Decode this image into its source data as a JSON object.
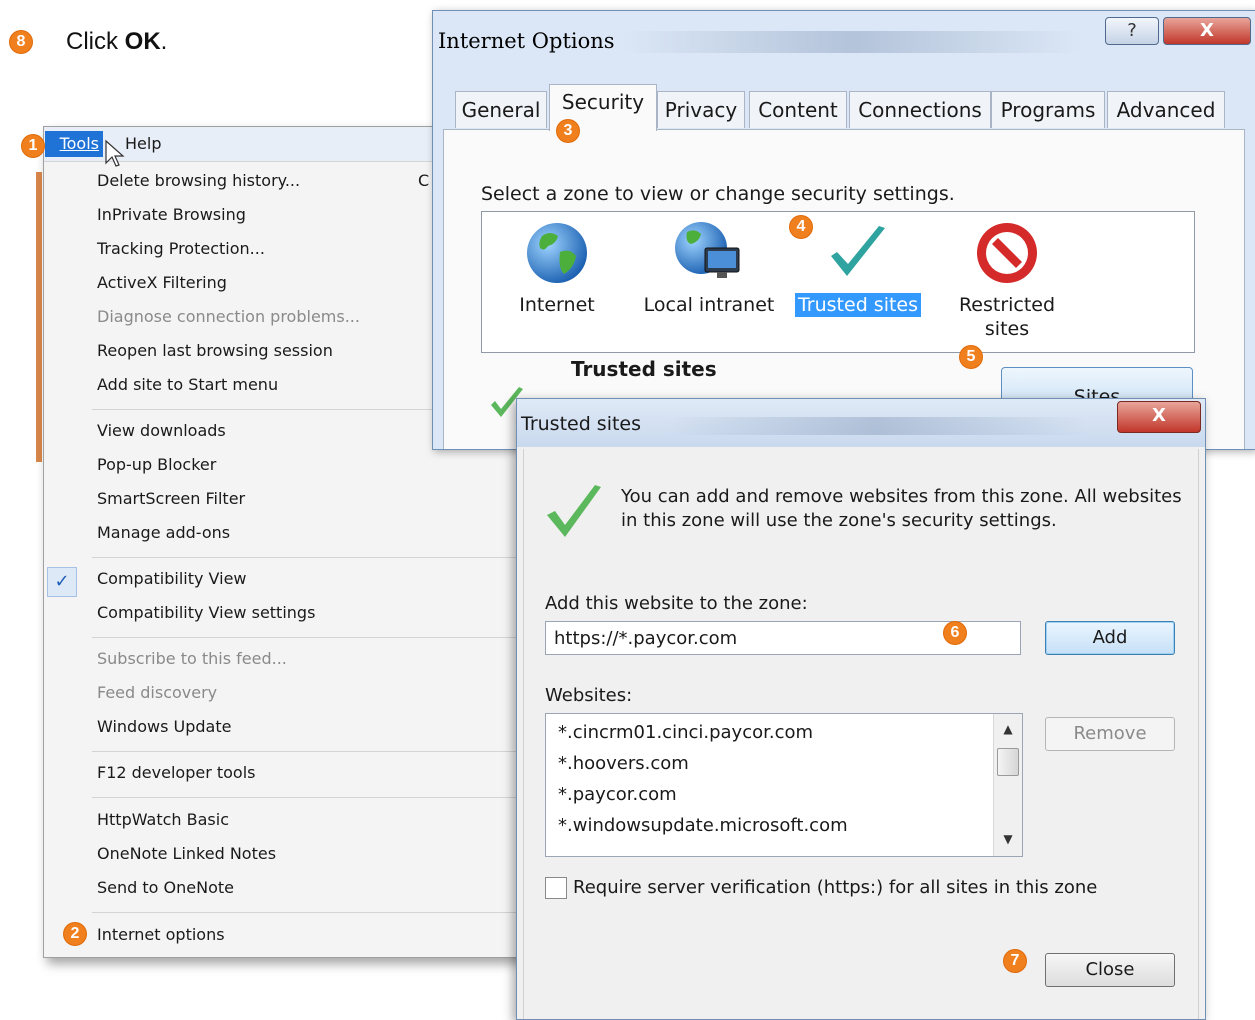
{
  "instruction": {
    "step": "8",
    "prefix": "Click ",
    "bold": "OK",
    "suffix": "."
  },
  "steps": {
    "s1": "1",
    "s2": "2",
    "s3": "3",
    "s4": "4",
    "s5": "5",
    "s6": "6",
    "s7": "7"
  },
  "menu": {
    "bar": {
      "tools": "Tools",
      "help": "Help"
    },
    "items": [
      "Delete browsing history...",
      "InPrivate Browsing",
      "Tracking Protection...",
      "ActiveX Filtering",
      "Diagnose connection problems...",
      "Reopen last browsing session",
      "Add site to Start menu",
      "View downloads",
      "Pop-up Blocker",
      "SmartScreen Filter",
      "Manage add-ons",
      "Compatibility View",
      "Compatibility View settings",
      "Subscribe to this feed...",
      "Feed discovery",
      "Windows Update",
      "F12 developer tools",
      "HttpWatch Basic",
      "OneNote Linked Notes",
      "Send to OneNote",
      "Internet options"
    ],
    "clipped_shortcut": "C",
    "checkmark": "✓"
  },
  "internet_options": {
    "title": "Internet Options",
    "help_btn": "?",
    "close_btn": "X",
    "tabs": [
      "General",
      "Security",
      "Privacy",
      "Content",
      "Connections",
      "Programs",
      "Advanced"
    ],
    "zone_caption": "Select a zone to view or change security settings.",
    "zones": [
      "Internet",
      "Local intranet",
      "Trusted sites",
      "Restricted",
      "sites"
    ],
    "selected_zone_title": "Trusted sites",
    "sites_button": "Sites"
  },
  "trusted_sites": {
    "title": "Trusted sites",
    "close_btn": "X",
    "description": "You can add and remove websites from this zone. All websites in this zone will use the zone's security settings.",
    "add_label": "Add this website to the zone:",
    "add_value": "https://*.paycor.com",
    "add_button": "Add",
    "websites_label": "Websites:",
    "websites": [
      "*.cincrm01.cinci.paycor.com",
      "*.hoovers.com",
      "*.paycor.com",
      "*.windowsupdate.microsoft.com"
    ],
    "remove_button": "Remove",
    "require_label": "Require server verification (https:) for all sites in this zone",
    "close_button": "Close"
  },
  "colors": {
    "step_badge": "#f07f1e",
    "selection": "#3399ff",
    "menu_highlight": "#1f73d6"
  }
}
